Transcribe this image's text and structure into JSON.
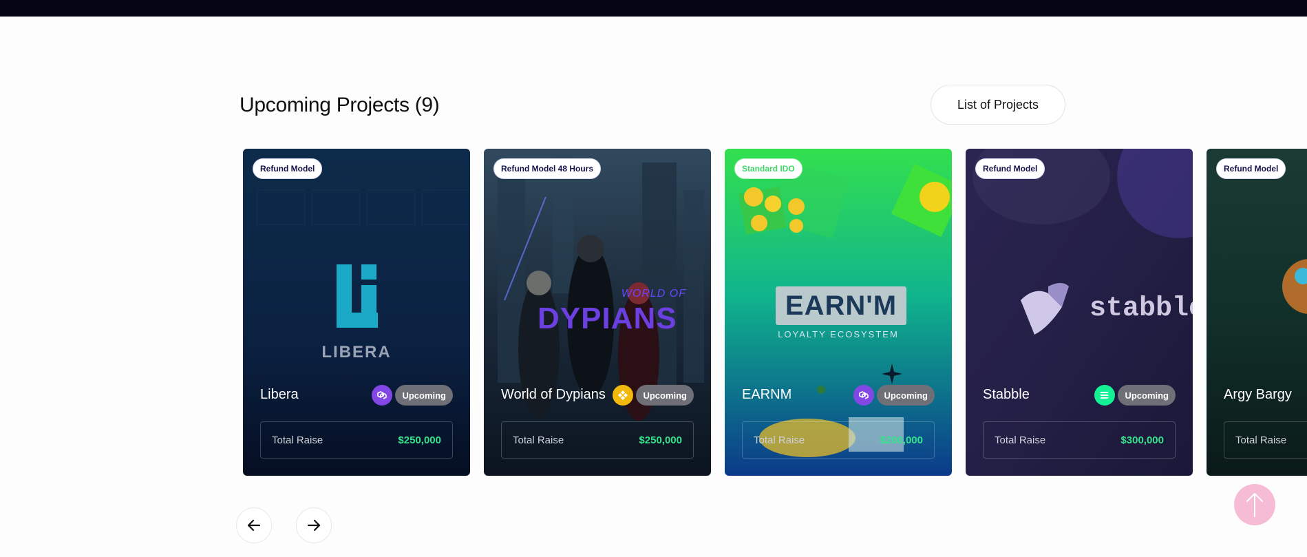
{
  "section": {
    "title": "Upcoming Projects (9)",
    "list_button": "List of Projects"
  },
  "cards": [
    {
      "badge": "Refund Model",
      "name": "Libera",
      "chain_icon": "polygon-icon",
      "status": "Upcoming",
      "raise_label": "Total Raise",
      "raise_value": "$250,000",
      "logo_text": "LIBERA"
    },
    {
      "badge": "Refund Model 48 Hours",
      "name": "World of Dypians",
      "chain_icon": "bnb-icon",
      "status": "Upcoming",
      "raise_label": "Total Raise",
      "raise_value": "$250,000",
      "logo_top": "WORLD OF",
      "logo_main": "DYPIANS"
    },
    {
      "badge": "Standard IDO",
      "name": "EARNM",
      "chain_icon": "polygon-icon",
      "status": "Upcoming",
      "raise_label": "Total Raise",
      "raise_value": "$200,000",
      "logo_main": "EARN'M",
      "logo_sub": "LOYALTY ECOSYSTEM"
    },
    {
      "badge": "Refund Model",
      "name": "Stabble",
      "chain_icon": "solana-icon",
      "status": "Upcoming",
      "raise_label": "Total Raise",
      "raise_value": "$300,000",
      "logo_main": "stabble"
    },
    {
      "badge": "Refund Model",
      "name": "Argy Bargy",
      "raise_label": "Total Raise"
    }
  ],
  "colors": {
    "accent_green": "#37e28d",
    "status_bg": "#6e6f77",
    "polygon": "#8247e5",
    "bnb": "#f0b90b",
    "solana": "#14f195",
    "scroll_top": "#f6bcd6"
  },
  "nav": {
    "prev_icon": "arrow-left-icon",
    "next_icon": "arrow-right-icon",
    "scroll_top_icon": "arrow-up-icon"
  }
}
